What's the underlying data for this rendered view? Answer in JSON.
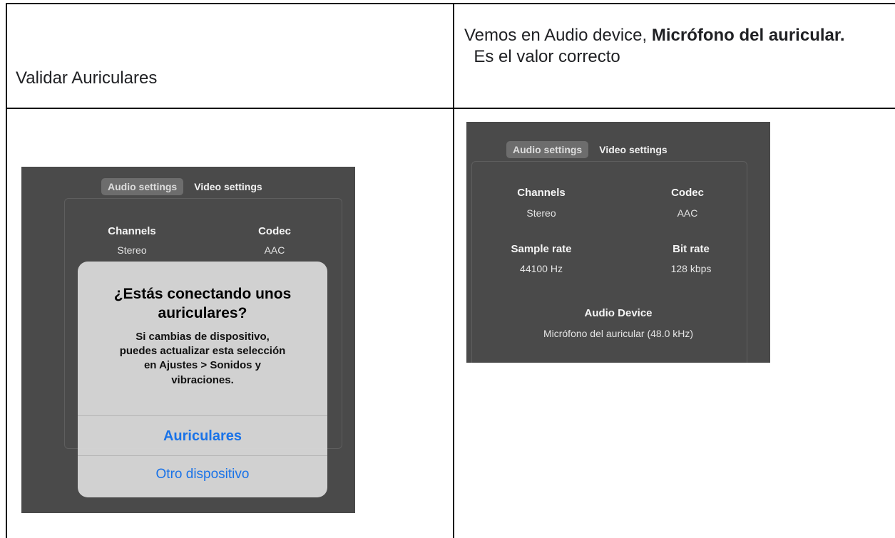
{
  "row1": {
    "left_text": "Validar Auriculares",
    "right_text_prefix": "Vemos en Audio device, ",
    "right_text_bold": "Micrófono del auricular.",
    "right_text_suffix": "  Es el valor correcto"
  },
  "left_shot": {
    "tabs": [
      "Audio settings",
      "Video settings"
    ],
    "channels_label": "Channels",
    "channels_value": "Stereo",
    "codec_label": "Codec",
    "codec_value": "AAC",
    "alert": {
      "title_line1": "¿Estás conectando unos",
      "title_line2": "auriculares?",
      "message_lines": [
        "Si cambias de dispositivo,",
        "puedes actualizar esta selección",
        "en Ajustes > Sonidos y",
        "vibraciones."
      ],
      "primary_button": "Auriculares",
      "secondary_button": "Otro dispositivo"
    }
  },
  "right_shot": {
    "tabs": [
      "Audio settings",
      "Video settings"
    ],
    "channels_label": "Channels",
    "channels_value": "Stereo",
    "codec_label": "Codec",
    "codec_value": "AAC",
    "sample_rate_label": "Sample rate",
    "sample_rate_value": "44100 Hz",
    "bit_rate_label": "Bit rate",
    "bit_rate_value": "128 kbps",
    "audio_device_label": "Audio Device",
    "audio_device_value": "Micrófono del auricular (48.0 kHz)"
  },
  "colors": {
    "panel_bg": "#4a4a4a",
    "alert_bg": "#d6d6d6",
    "alert_button": "#1a73e8",
    "border": "#000000"
  }
}
